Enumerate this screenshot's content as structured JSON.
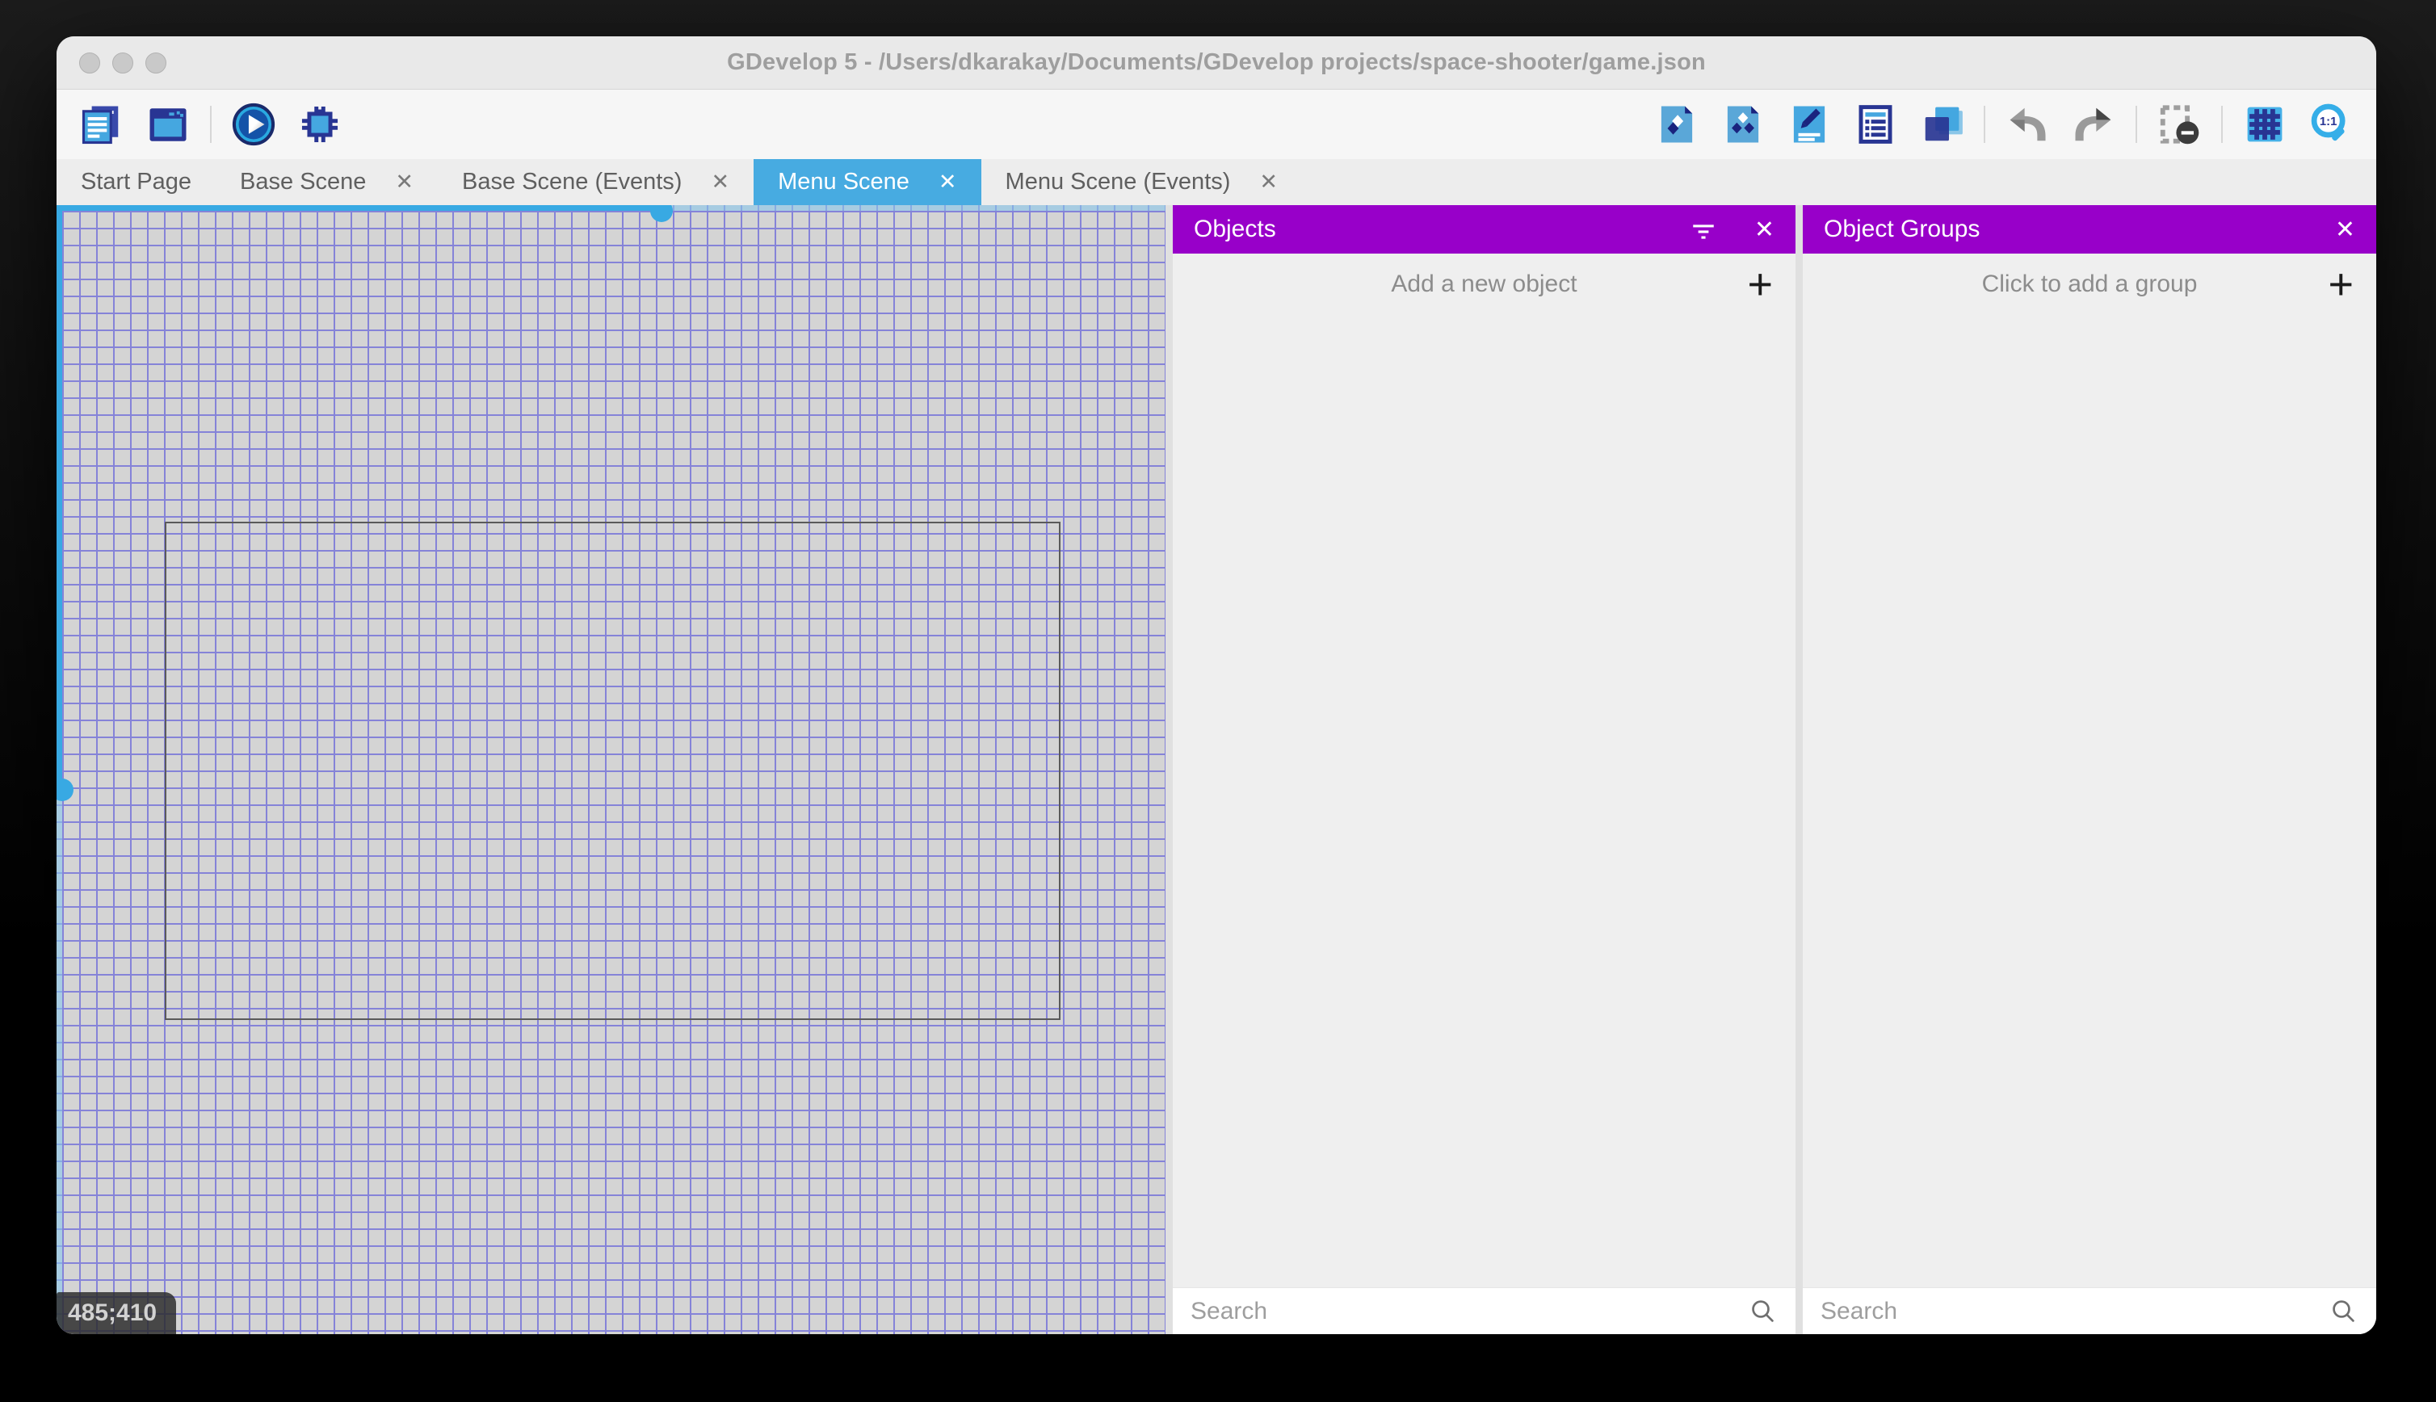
{
  "window": {
    "title": "GDevelop 5 - /Users/dkarakay/Documents/GDevelop projects/space-shooter/game.json"
  },
  "toolbar": {
    "icons_left": [
      "project-manager",
      "preview-window",
      "play-preview",
      "debugger"
    ],
    "icons_right": [
      "objects-editor",
      "object-groups-editor",
      "properties-panel",
      "instances-list",
      "layers-editor",
      "undo",
      "redo",
      "window-mask",
      "toggle-grid",
      "zoom-one-to-one"
    ]
  },
  "tabs": [
    {
      "label": "Start Page",
      "closable": false,
      "active": false
    },
    {
      "label": "Base Scene",
      "closable": true,
      "active": false
    },
    {
      "label": "Base Scene (Events)",
      "closable": true,
      "active": false
    },
    {
      "label": "Menu Scene",
      "closable": true,
      "active": true
    },
    {
      "label": "Menu Scene (Events)",
      "closable": true,
      "active": false
    }
  ],
  "tab_close_glyph": "✕",
  "canvas": {
    "coordinates": "485;410"
  },
  "objects_panel": {
    "title": "Objects",
    "action": "Add a new object",
    "plus": "+",
    "close_glyph": "✕",
    "search_placeholder": "Search"
  },
  "groups_panel": {
    "title": "Object Groups",
    "action": "Click to add a group",
    "plus": "+",
    "close_glyph": "✕",
    "search_placeholder": "Search"
  },
  "colors": {
    "accent_blue": "#47abe1",
    "scrollbar_blue": "#38a9e3",
    "header_purple": "#9800c9",
    "grid_line": "#8583d8",
    "grid_background": "#d4d4d4"
  }
}
